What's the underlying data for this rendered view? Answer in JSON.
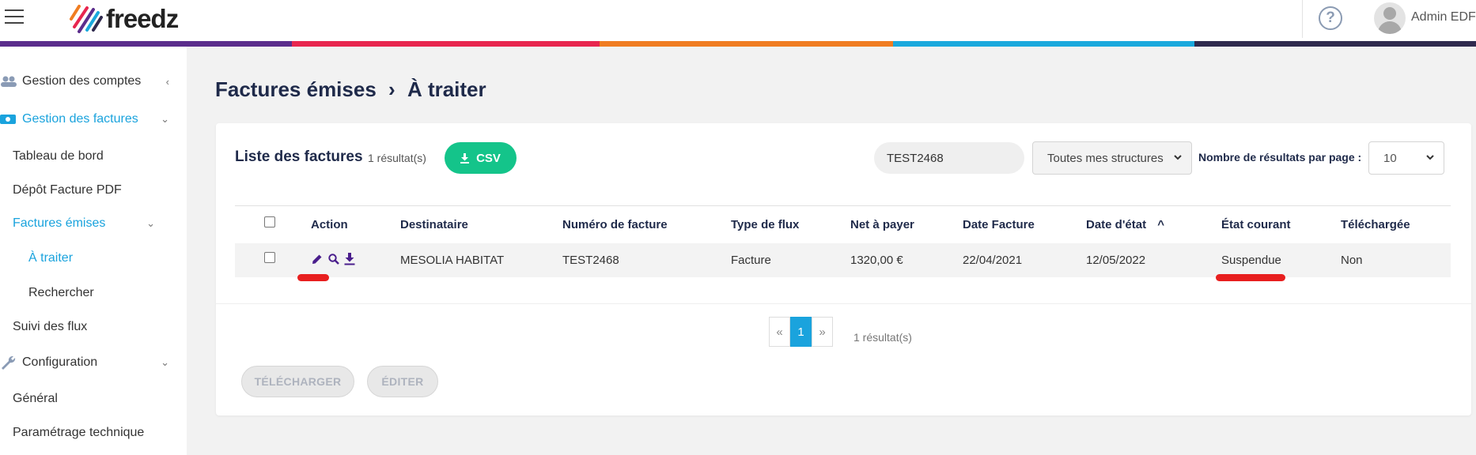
{
  "header": {
    "brand": "freedz",
    "help_label": "?",
    "user_name": "Admin EDF",
    "color_bar": [
      "#5b2d8c",
      "#e8264f",
      "#f07d21",
      "#1aa9dd",
      "#2f2a4e"
    ]
  },
  "sidebar": {
    "items": [
      {
        "label": "Gestion des comptes",
        "icon": "users-icon",
        "chevron": "‹"
      },
      {
        "label": "Gestion des factures",
        "icon": "invoice-icon",
        "chevron": "⌄"
      },
      {
        "label": "Tableau de bord"
      },
      {
        "label": "Dépôt Facture PDF"
      },
      {
        "label": "Factures émises",
        "chevron": "⌄"
      },
      {
        "label": "À traiter"
      },
      {
        "label": "Rechercher"
      },
      {
        "label": "Suivi des flux"
      },
      {
        "label": "Configuration",
        "icon": "wrench-icon",
        "chevron": "⌄"
      },
      {
        "label": "Général"
      },
      {
        "label": "Paramétrage technique"
      }
    ]
  },
  "main": {
    "breadcrumb_parent": "Factures émises",
    "breadcrumb_sep": "›",
    "breadcrumb_current": "À traiter",
    "list_title": "Liste des factures",
    "result_count": "1 résultat(s)",
    "csv_label": "CSV",
    "search_value": "TEST2468",
    "structure_select": "Toutes mes structures",
    "per_page_label": "Nombre de résultats par page :",
    "per_page_value": "10"
  },
  "table": {
    "columns": [
      "Action",
      "Destinataire",
      "Numéro de facture",
      "Type de flux",
      "Net à payer",
      "Date Facture",
      "Date d'état",
      "État courant",
      "Téléchargée"
    ],
    "sort_indicator": "^",
    "rows": [
      {
        "destinataire": "MESOLIA HABITAT",
        "numero": "TEST2468",
        "type_flux": "Facture",
        "net_a_payer": "1320,00 €",
        "date_facture": "22/04/2021",
        "date_etat": "12/05/2022",
        "etat": "Suspendue",
        "telechargee": "Non"
      }
    ]
  },
  "pagination": {
    "prev": "«",
    "current": "1",
    "next": "»",
    "count": "1 résultat(s)"
  },
  "actions": {
    "download_label": "TÉLÉCHARGER",
    "edit_label": "ÉDITER"
  },
  "colors": {
    "accent": "#1aa3dd",
    "csv_button": "#14c48a",
    "highlight": "#e81f1f",
    "title": "#1f2a4a"
  }
}
